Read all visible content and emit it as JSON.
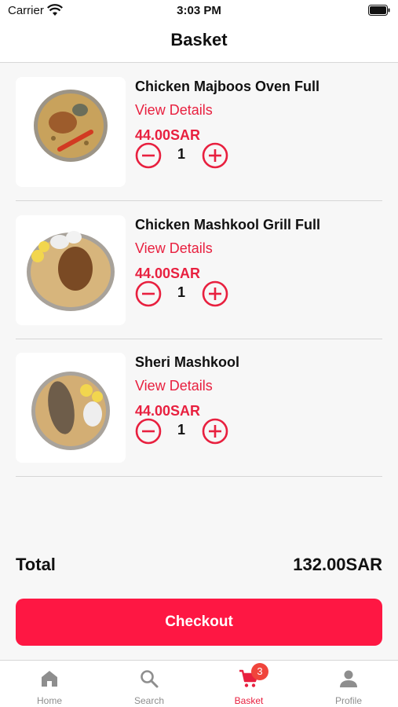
{
  "status_bar": {
    "carrier": "Carrier",
    "time": "3:03 PM"
  },
  "header": {
    "title": "Basket"
  },
  "items": [
    {
      "name": "Chicken Majboos Oven Full",
      "details_label": "View Details",
      "price": "44.00SAR",
      "quantity": "1"
    },
    {
      "name": "Chicken Mashkool Grill Full",
      "details_label": "View Details",
      "price": "44.00SAR",
      "quantity": "1"
    },
    {
      "name": "Sheri Mashkool",
      "details_label": "View Details",
      "price": "44.00SAR",
      "quantity": "1"
    }
  ],
  "summary": {
    "total_label": "Total",
    "total_value": "132.00SAR"
  },
  "checkout": {
    "label": "Checkout"
  },
  "tab_bar": {
    "tabs": [
      {
        "label": "Home",
        "icon": "home-icon"
      },
      {
        "label": "Search",
        "icon": "search-icon"
      },
      {
        "label": "Basket",
        "icon": "cart-icon",
        "badge": "3",
        "active": true
      },
      {
        "label": "Profile",
        "icon": "person-icon"
      }
    ]
  },
  "colors": {
    "accent": "#fe1743",
    "text": "#111111",
    "inactive": "#8e8e8e",
    "background": "#f7f7f7"
  }
}
